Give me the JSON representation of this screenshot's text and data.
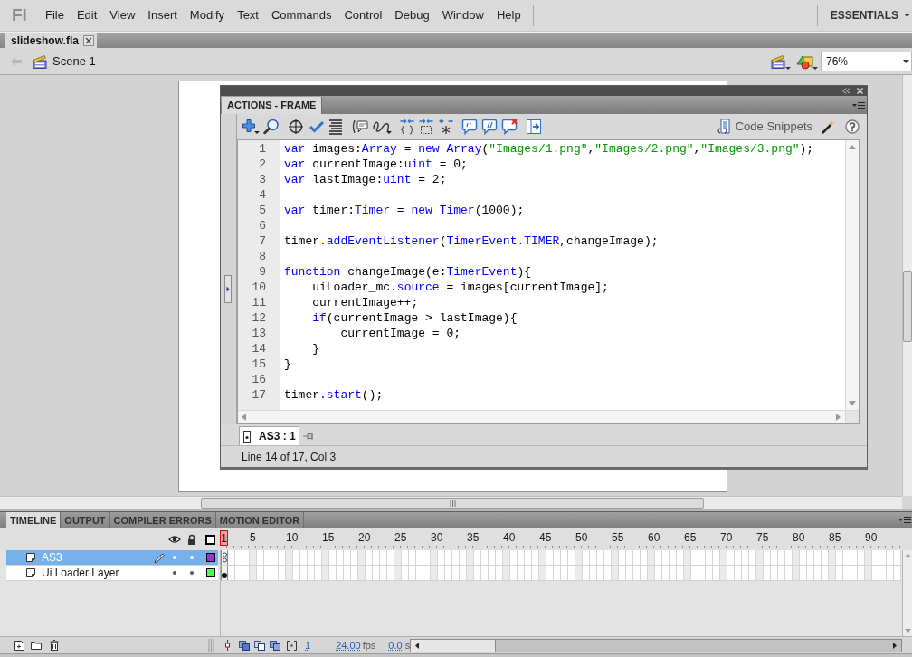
{
  "menu_bar": {
    "logo": "Fl",
    "items": [
      "File",
      "Edit",
      "View",
      "Insert",
      "Modify",
      "Text",
      "Commands",
      "Control",
      "Debug",
      "Window",
      "Help"
    ],
    "workspace": "ESSENTIALS"
  },
  "document_tabs": [
    {
      "label": "slideshow.fla",
      "selected": true
    }
  ],
  "edit_bar": {
    "scene": "Scene 1",
    "zoom": "76%"
  },
  "actions_panel": {
    "title": "ACTIONS - FRAME",
    "code_snippets": "Code Snippets",
    "code_lines": [
      {
        "number": "1",
        "segments": [
          {
            "kind": "keyword",
            "text": "var"
          },
          {
            "kind": "plain",
            "text": " images:"
          },
          {
            "kind": "keyword",
            "text": "Array"
          },
          {
            "kind": "plain",
            "text": " = "
          },
          {
            "kind": "keyword",
            "text": "new Array"
          },
          {
            "kind": "plain",
            "text": "("
          },
          {
            "kind": "string",
            "text": "\"Images/1.png\""
          },
          {
            "kind": "plain",
            "text": ","
          },
          {
            "kind": "string",
            "text": "\"Images/2.png\""
          },
          {
            "kind": "plain",
            "text": ","
          },
          {
            "kind": "string",
            "text": "\"Images/3.png\""
          },
          {
            "kind": "plain",
            "text": ");"
          }
        ]
      },
      {
        "number": "2",
        "segments": [
          {
            "kind": "keyword",
            "text": "var"
          },
          {
            "kind": "plain",
            "text": " currentImage:"
          },
          {
            "kind": "keyword",
            "text": "uint"
          },
          {
            "kind": "plain",
            "text": " = 0;"
          }
        ]
      },
      {
        "number": "3",
        "segments": [
          {
            "kind": "keyword",
            "text": "var"
          },
          {
            "kind": "plain",
            "text": " lastImage:"
          },
          {
            "kind": "keyword",
            "text": "uint"
          },
          {
            "kind": "plain",
            "text": " = 2;"
          }
        ]
      },
      {
        "number": "4"
      },
      {
        "number": "5",
        "segments": [
          {
            "kind": "keyword",
            "text": "var"
          },
          {
            "kind": "plain",
            "text": " timer:"
          },
          {
            "kind": "keyword",
            "text": "Timer"
          },
          {
            "kind": "plain",
            "text": " = "
          },
          {
            "kind": "keyword",
            "text": "new Timer"
          },
          {
            "kind": "plain",
            "text": "(1000);"
          }
        ]
      },
      {
        "number": "6"
      },
      {
        "number": "7",
        "segments": [
          {
            "kind": "plain",
            "text": "timer"
          },
          {
            "kind": "keyword",
            "text": ".addEventListener"
          },
          {
            "kind": "plain",
            "text": "("
          },
          {
            "kind": "keyword",
            "text": "TimerEvent.TIMER"
          },
          {
            "kind": "plain",
            "text": ",changeImage);"
          }
        ]
      },
      {
        "number": "8"
      },
      {
        "number": "9",
        "segments": [
          {
            "kind": "keyword",
            "text": "function"
          },
          {
            "kind": "plain",
            "text": " changeImage(e:"
          },
          {
            "kind": "keyword",
            "text": "TimerEvent"
          },
          {
            "kind": "plain",
            "text": "){"
          }
        ]
      },
      {
        "number": "10",
        "segments": [
          {
            "kind": "plain",
            "text": "    uiLoader_mc"
          },
          {
            "kind": "keyword",
            "text": ".source"
          },
          {
            "kind": "plain",
            "text": " = images[currentImage];"
          }
        ]
      },
      {
        "number": "11",
        "segments": [
          {
            "kind": "plain",
            "text": "    currentImage++;"
          }
        ]
      },
      {
        "number": "12",
        "segments": [
          {
            "kind": "keyword",
            "text": "    if"
          },
          {
            "kind": "plain",
            "text": "(currentImage > lastImage){"
          }
        ]
      },
      {
        "number": "13",
        "segments": [
          {
            "kind": "plain",
            "text": "        currentImage = 0;"
          }
        ]
      },
      {
        "number": "14",
        "segments": [
          {
            "kind": "plain",
            "text": "    }"
          }
        ]
      },
      {
        "number": "15",
        "segments": [
          {
            "kind": "plain",
            "text": "}"
          }
        ]
      },
      {
        "number": "16"
      },
      {
        "number": "17",
        "segments": [
          {
            "kind": "plain",
            "text": "timer"
          },
          {
            "kind": "keyword",
            "text": ".start"
          },
          {
            "kind": "plain",
            "text": "();"
          }
        ]
      }
    ],
    "script_tabs": [
      {
        "label": "AS3 : 1",
        "selected": true
      }
    ],
    "status": "Line 14 of 17, Col 3"
  },
  "timeline": {
    "tabs": [
      {
        "label": "TIMELINE",
        "selected": true
      },
      {
        "label": "OUTPUT",
        "selected": false
      },
      {
        "label": "COMPILER ERRORS",
        "selected": false
      },
      {
        "label": "MOTION EDITOR",
        "selected": false
      }
    ],
    "frame_numbers": [
      "1",
      "5",
      "10",
      "15",
      "20",
      "25",
      "30",
      "35",
      "40",
      "45",
      "50",
      "55",
      "60",
      "65",
      "70",
      "75",
      "80",
      "85",
      "90"
    ],
    "layers": [
      {
        "name": "AS3",
        "selected": true,
        "color": "#9933cc",
        "kind": "script"
      },
      {
        "name": "Ui Loader Layer",
        "selected": false,
        "color": "#4dff4d",
        "kind": "content"
      }
    ],
    "current_frame": "1",
    "frame_rate": "24.00",
    "frame_rate_unit": "fps",
    "elapsed_time": "0.0",
    "elapsed_unit": "s"
  }
}
